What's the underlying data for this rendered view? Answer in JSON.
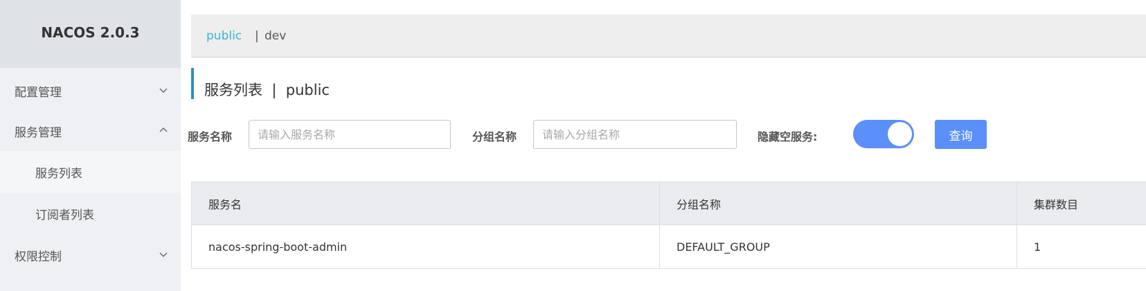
{
  "brand": {
    "title": "NACOS 2.0.3"
  },
  "sidebar": {
    "items": [
      {
        "label": "配置管理",
        "chevron": "down"
      },
      {
        "label": "服务管理",
        "chevron": "up"
      },
      {
        "label": "服务列表",
        "active": true
      },
      {
        "label": "订阅者列表"
      },
      {
        "label": "权限控制",
        "chevron": "down"
      }
    ]
  },
  "namespaces": {
    "active": "public",
    "separator": "|",
    "other": "dev"
  },
  "page": {
    "title": "服务列表  |  public"
  },
  "filters": {
    "service_name_label": "服务名称",
    "service_name_placeholder": "请输入服务名称",
    "group_name_label": "分组名称",
    "group_name_placeholder": "请输入分组名称",
    "hide_empty_label": "隐藏空服务:",
    "hide_empty_on": true,
    "query_label": "查询"
  },
  "table": {
    "columns": [
      "服务名",
      "分组名称",
      "集群数目"
    ],
    "rows": [
      [
        "nacos-spring-boot-admin",
        "DEFAULT_GROUP",
        "1"
      ]
    ]
  },
  "colors": {
    "accent": "#5b8ff9",
    "ns_active": "#2fb7d6",
    "title_bar": "#2a8fbd"
  }
}
